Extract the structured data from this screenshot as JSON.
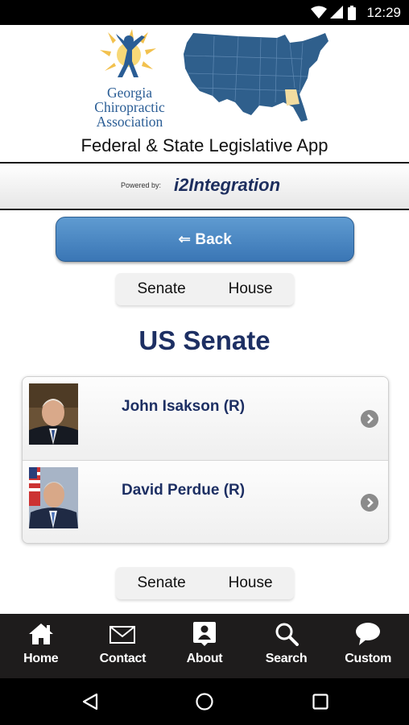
{
  "status_bar": {
    "time": "12:29",
    "icons": [
      "wifi-icon",
      "signal-icon",
      "battery-icon"
    ]
  },
  "header": {
    "org_name_line1": "Georgia",
    "org_name_line2": "Chiropractic",
    "org_name_line3": "Association",
    "app_title": "Federal & State Legislative App"
  },
  "powered": {
    "label": "Powered by:",
    "brand": "i2Integration"
  },
  "back_button": {
    "label": "⇐ Back"
  },
  "tabs": {
    "senate": "Senate",
    "house": "House"
  },
  "section_title": "US Senate",
  "senators": [
    {
      "name": "John Isakson (R)"
    },
    {
      "name": "David Perdue (R)"
    }
  ],
  "bottom_nav": [
    {
      "label": "Home",
      "icon": "home-icon"
    },
    {
      "label": "Contact",
      "icon": "envelope-icon"
    },
    {
      "label": "About",
      "icon": "about-person-icon"
    },
    {
      "label": "Search",
      "icon": "search-icon"
    },
    {
      "label": "Custom",
      "icon": "speech-bubble-icon"
    }
  ],
  "colors": {
    "brand_blue": "#2a5d95",
    "title_navy": "#1d2f63",
    "button_blue": "#4a87c3",
    "map_blue": "#2f5f8c",
    "georgia_highlight": "#f2dca0"
  }
}
